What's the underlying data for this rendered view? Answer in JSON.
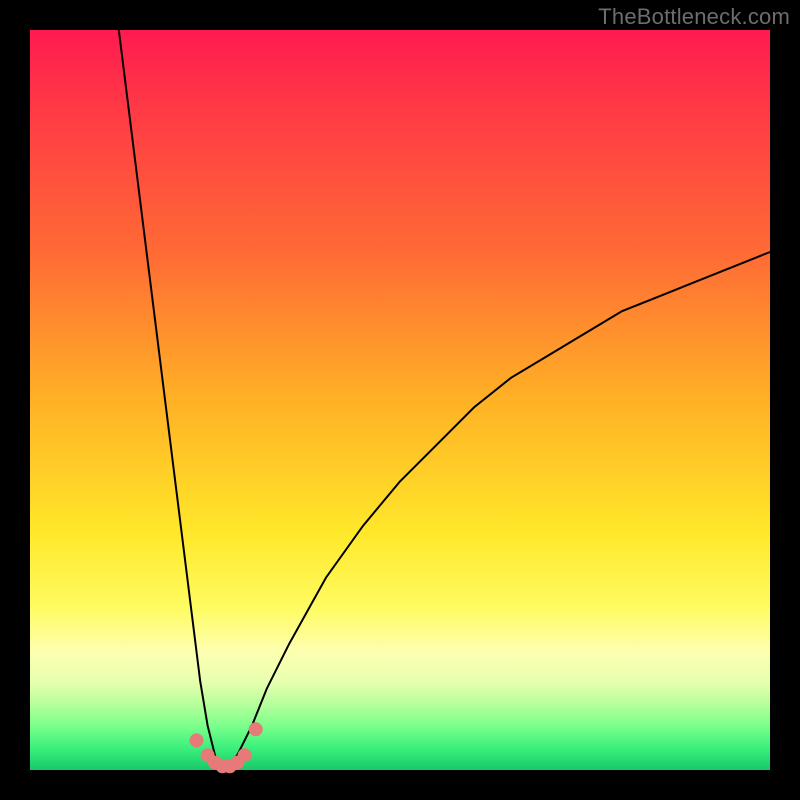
{
  "watermark": "TheBottleneck.com",
  "chart_data": {
    "type": "line",
    "title": "",
    "xlabel": "",
    "ylabel": "",
    "xlim": [
      0,
      100
    ],
    "ylim": [
      0,
      100
    ],
    "grid": false,
    "note": "V-shaped bottleneck curve. y≈0 at horizontal minimum (~x=26); tall steep left arm exits top near x≈12; right arm rises more gradually, exiting right edge near y≈70.",
    "minimum_x": 26,
    "series": [
      {
        "name": "bottleneck-curve",
        "x": [
          12,
          14,
          16,
          18,
          20,
          22,
          23,
          24,
          25,
          26,
          27,
          28,
          29,
          30,
          32,
          35,
          40,
          45,
          50,
          55,
          60,
          65,
          70,
          75,
          80,
          85,
          90,
          95,
          100
        ],
        "values": [
          100,
          84,
          68,
          52,
          36,
          20,
          12,
          6,
          2,
          0,
          1,
          2,
          4,
          6,
          11,
          17,
          26,
          33,
          39,
          44,
          49,
          53,
          56,
          59,
          62,
          64,
          66,
          68,
          70
        ]
      }
    ],
    "markers": {
      "name": "highlight-dots",
      "color": "#e67a78",
      "x": [
        22.5,
        24.0,
        25.0,
        26.0,
        27.0,
        28.0,
        29.0,
        30.5
      ],
      "values": [
        4.0,
        2.0,
        1.0,
        0.5,
        0.5,
        1.0,
        2.0,
        5.5
      ]
    },
    "background_gradient": {
      "orientation": "vertical",
      "stops": [
        {
          "pos": 0,
          "color": "#ff1a50"
        },
        {
          "pos": 50,
          "color": "#ffb125"
        },
        {
          "pos": 78,
          "color": "#fffb60"
        },
        {
          "pos": 100,
          "color": "#18c86a"
        }
      ]
    }
  }
}
